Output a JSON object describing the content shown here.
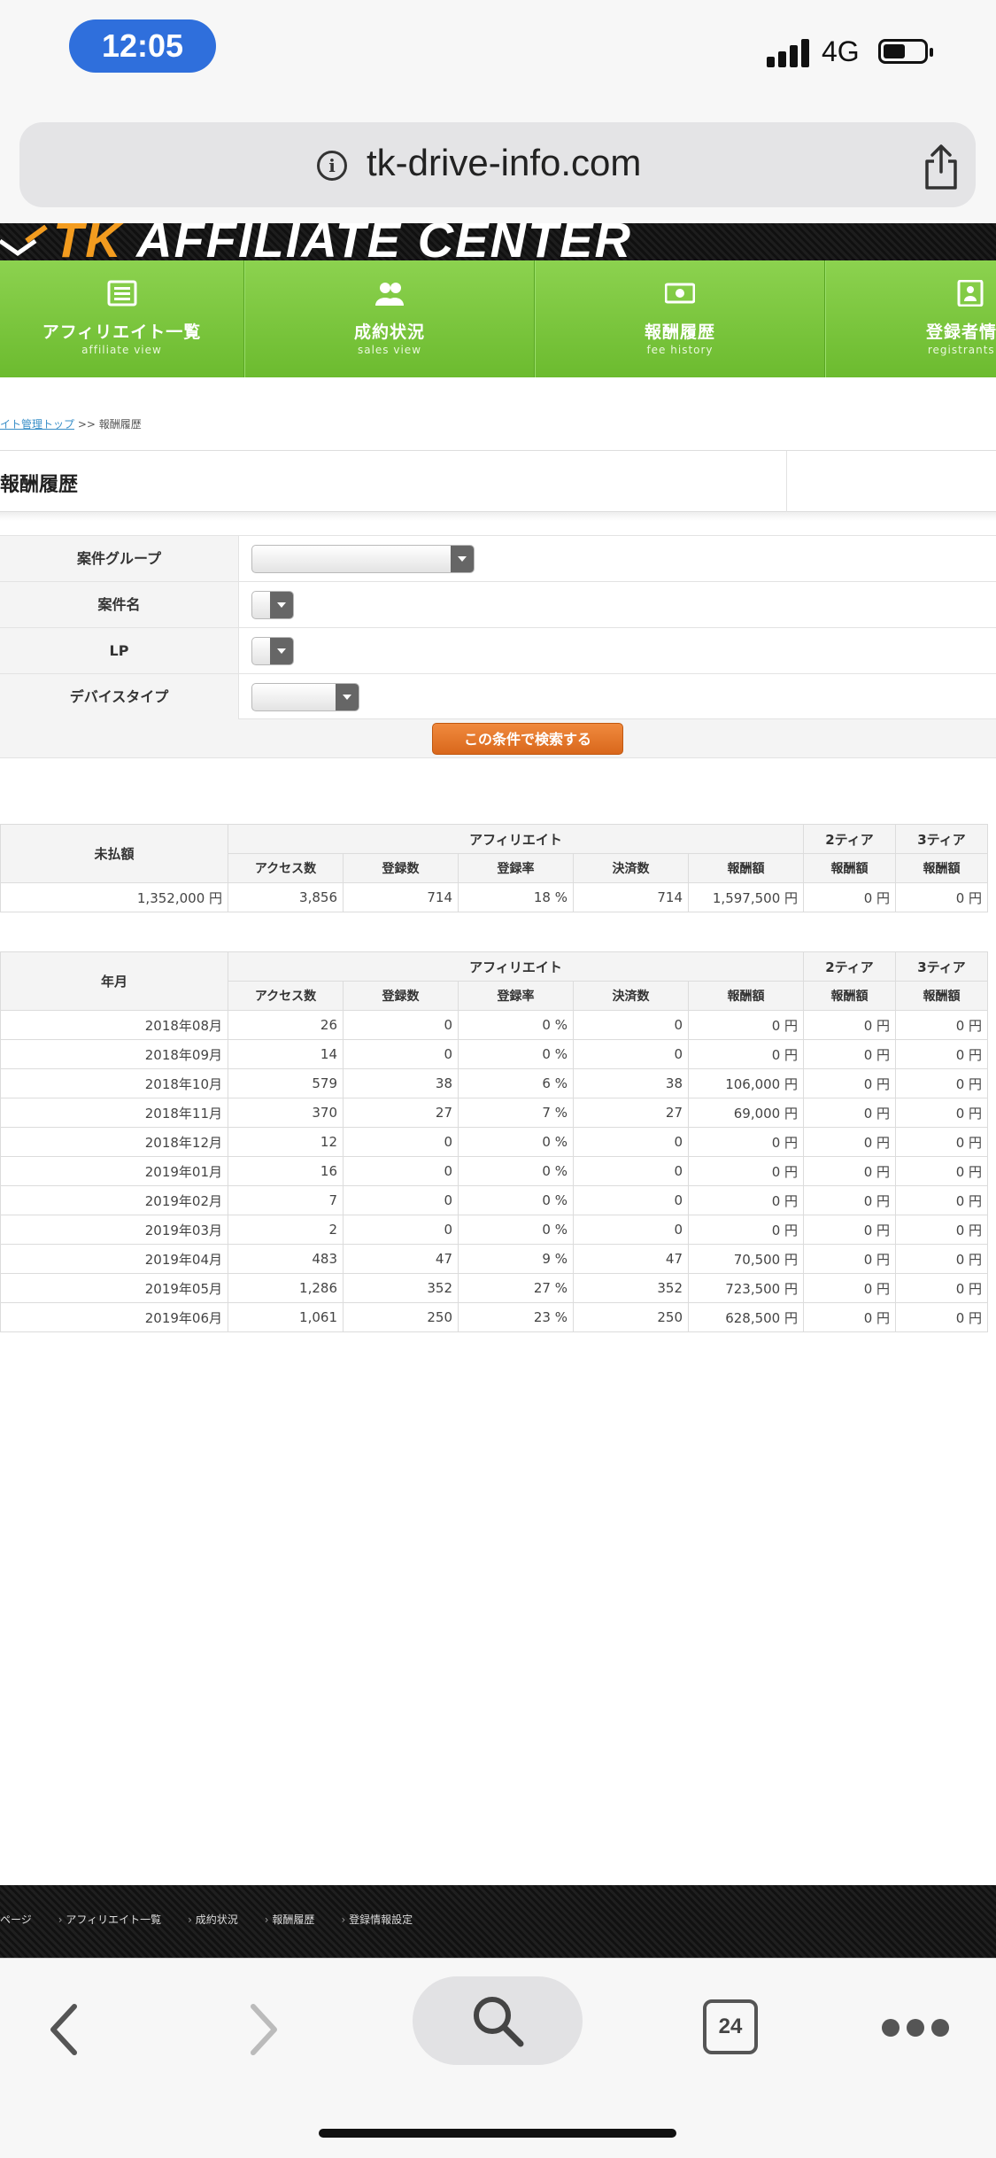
{
  "status": {
    "time": "12:05",
    "network": "4G"
  },
  "browser": {
    "url": "tk-drive-info.com",
    "tab_count": "24"
  },
  "site": {
    "banner_tk": "TK",
    "banner_rest": " AFFILIATE CENTER",
    "nav": [
      {
        "label": "アフィリエイト一覧",
        "sub": "affiliate view",
        "icon": "list-icon"
      },
      {
        "label": "成約状況",
        "sub": "sales view",
        "icon": "users-icon"
      },
      {
        "label": "報酬履歴",
        "sub": "fee history",
        "icon": "money-icon"
      },
      {
        "label": "登録者情報",
        "sub": "registrants se",
        "icon": "registrant-icon"
      }
    ]
  },
  "breadcrumb": {
    "link": "イト管理トップ",
    "sep": ">>",
    "current": "報酬履歴"
  },
  "page_title": "報酬履歴",
  "filter": {
    "rows": [
      {
        "label": "案件グループ",
        "value": ""
      },
      {
        "label": "案件名",
        "value": ""
      },
      {
        "label": "LP",
        "value": ""
      },
      {
        "label": "デバイスタイプ",
        "value": ""
      }
    ],
    "search_button": "この条件で検索する"
  },
  "summary_table": {
    "first_header": "未払額",
    "group_affiliate": "アフィリエイト",
    "group_tier2": "2ティア",
    "group_tier3": "3ティア",
    "sub_headers": [
      "アクセス数",
      "登録数",
      "登録率",
      "決済数",
      "報酬額",
      "報酬額",
      "報酬額"
    ],
    "row": [
      "1,352,000 円",
      "3,856",
      "714",
      "18 %",
      "714",
      "1,597,500 円",
      "0 円",
      "0 円"
    ]
  },
  "monthly_table": {
    "first_header": "年月",
    "group_affiliate": "アフィリエイト",
    "group_tier2": "2ティア",
    "group_tier3": "3ティア",
    "sub_headers": [
      "アクセス数",
      "登録数",
      "登録率",
      "決済数",
      "報酬額",
      "報酬額",
      "報酬額"
    ],
    "rows": [
      [
        "2018年08月",
        "26",
        "0",
        "0 %",
        "0",
        "0 円",
        "0 円",
        "0 円"
      ],
      [
        "2018年09月",
        "14",
        "0",
        "0 %",
        "0",
        "0 円",
        "0 円",
        "0 円"
      ],
      [
        "2018年10月",
        "579",
        "38",
        "6 %",
        "38",
        "106,000 円",
        "0 円",
        "0 円"
      ],
      [
        "2018年11月",
        "370",
        "27",
        "7 %",
        "27",
        "69,000 円",
        "0 円",
        "0 円"
      ],
      [
        "2018年12月",
        "12",
        "0",
        "0 %",
        "0",
        "0 円",
        "0 円",
        "0 円"
      ],
      [
        "2019年01月",
        "16",
        "0",
        "0 %",
        "0",
        "0 円",
        "0 円",
        "0 円"
      ],
      [
        "2019年02月",
        "7",
        "0",
        "0 %",
        "0",
        "0 円",
        "0 円",
        "0 円"
      ],
      [
        "2019年03月",
        "2",
        "0",
        "0 %",
        "0",
        "0 円",
        "0 円",
        "0 円"
      ],
      [
        "2019年04月",
        "483",
        "47",
        "9 %",
        "47",
        "70,500 円",
        "0 円",
        "0 円"
      ],
      [
        "2019年05月",
        "1,286",
        "352",
        "27 %",
        "352",
        "723,500 円",
        "0 円",
        "0 円"
      ],
      [
        "2019年06月",
        "1,061",
        "250",
        "23 %",
        "250",
        "628,500 円",
        "0 円",
        "0 円"
      ]
    ]
  },
  "footer_links": [
    "ページ",
    "アフィリエイト一覧",
    "成約状況",
    "報酬履歴",
    "登録情報設定"
  ]
}
